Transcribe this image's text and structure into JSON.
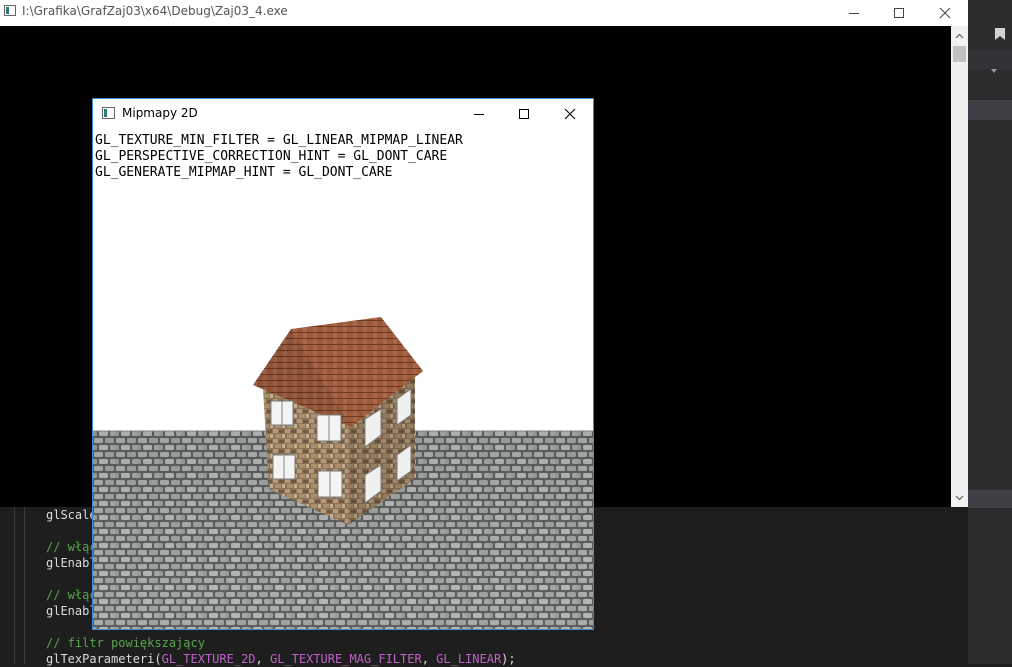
{
  "console_window": {
    "title": "I:\\Grafika\\GrafZaj03\\x64\\Debug\\Zaj03_4.exe",
    "buttons": {
      "minimize": "—",
      "maximize": "☐",
      "close": "✕"
    }
  },
  "gl_window": {
    "title": "Mipmapy 2D",
    "buttons": {
      "minimize": "—",
      "maximize": "☐",
      "close": "✕"
    },
    "overlay_lines": [
      "GL_TEXTURE_MIN_FILTER = GL_LINEAR_MIPMAP_LINEAR",
      "GL_PERSPECTIVE_CORRECTION_HINT = GL_DONT_CARE",
      "GL_GENERATE_MIPMAP_HINT = GL_DONT_CARE"
    ]
  },
  "code_editor": {
    "lines": [
      {
        "text": "glScale"
      },
      {
        "text": ""
      },
      {
        "text": "// włąc"
      },
      {
        "text": "glEnabl"
      },
      {
        "text": ""
      },
      {
        "text": "// włąc"
      },
      {
        "text": "glEnabl"
      },
      {
        "text": ""
      },
      {
        "text": "// filtr powiększający"
      },
      {
        "text": "glTexParameteri(GL_TEXTURE_2D, GL_TEXTURE_MAG_FILTER, GL_LINEAR);"
      }
    ],
    "last_line_parts": {
      "fn": "glTexParameteri(",
      "a1": "GL_TEXTURE_2D",
      "sep1": ", ",
      "a2": "GL_TEXTURE_MAG_FILTER",
      "sep2": ", ",
      "a3": "GL_LINEAR",
      "end": ");"
    }
  },
  "colors": {
    "console_bg": "#000000",
    "ide_bg": "#1e1e1e",
    "window_border": "#3c8ad6",
    "comment": "#57a64a",
    "macro": "#bd63c5"
  }
}
